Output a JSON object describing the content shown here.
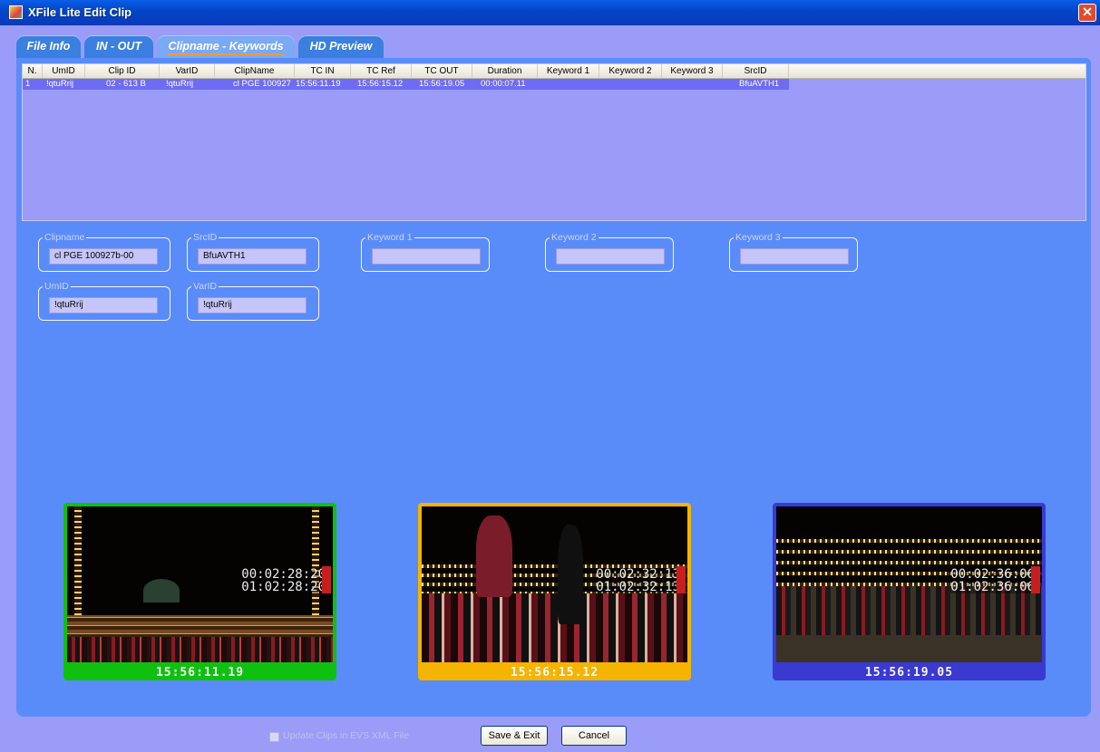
{
  "window": {
    "title": "XFile Lite Edit Clip",
    "close_glyph": "✕"
  },
  "tabs": [
    {
      "label": "File Info"
    },
    {
      "label": "IN - OUT"
    },
    {
      "label": "Clipname - Keywords"
    },
    {
      "label": "HD Preview"
    }
  ],
  "table": {
    "headers": [
      "N.",
      "UmID",
      "Clip ID",
      "VarID",
      "ClipName",
      "TC IN",
      "TC Ref",
      "TC OUT",
      "Duration",
      "Keyword 1",
      "Keyword 2",
      "Keyword 3",
      "SrcID"
    ],
    "rows": [
      [
        "1",
        "!qtuRrij",
        "02 - 613 B",
        "!qtuRrij",
        "cl PGE 100927",
        "15:56:11.19",
        "15:56:15.12",
        "15:56:19.05",
        "00:00:07.11",
        "",
        "",
        "",
        "BfuAVTH1"
      ]
    ]
  },
  "fields": {
    "clipname": {
      "label": "Clipname",
      "value": "cl PGE 100927b-00"
    },
    "srcid": {
      "label": "SrcID",
      "value": "BfuAVTH1"
    },
    "keyword1": {
      "label": "Keyword 1",
      "value": ""
    },
    "keyword2": {
      "label": "Keyword 2",
      "value": ""
    },
    "keyword3": {
      "label": "Keyword 3",
      "value": ""
    },
    "umid": {
      "label": "UmID",
      "value": "!qtuRrij"
    },
    "varid": {
      "label": "VarID",
      "value": "!qtuRrij"
    }
  },
  "previews": [
    {
      "timecode": "15:56:11.19",
      "overlay_line1": "00:02:28:20",
      "overlay_line2": "01:02:28:20",
      "frame_color": "#10c010"
    },
    {
      "timecode": "15:56:15.12",
      "overlay_line1": "00:02:32:13",
      "overlay_line2": "01:02:32:13",
      "frame_color": "#f4b400"
    },
    {
      "timecode": "15:56:19.05",
      "overlay_line1": "00:02:36:06",
      "overlay_line2": "01:02:36:06",
      "frame_color": "#3a3ad0"
    }
  ],
  "footer": {
    "checkbox_label": "Update Clips in EVS XML File",
    "save_label": "Save & Exit",
    "cancel_label": "Cancel"
  },
  "colors": {
    "accent": "#5a8cf9",
    "selected_row": "#6e6cf2"
  }
}
